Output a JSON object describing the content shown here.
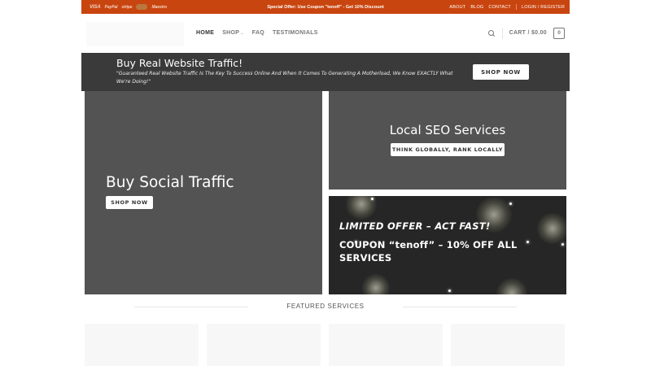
{
  "topbar": {
    "payment_icons": [
      "VISA",
      "PayPal",
      "stripe",
      "mastercard",
      "Maestro"
    ],
    "promo_text": "Special Offer: Use Coupon \"tenoff\" - Get 10% Discount",
    "links": {
      "about": "ABOUT",
      "blog": "BLOG",
      "contact": "CONTACT",
      "login": "LOGIN / REGISTER"
    },
    "background_color": "#c9450f"
  },
  "header": {
    "nav": {
      "home": "HOME",
      "shop": "SHOP",
      "faq": "FAQ",
      "testimonials": "TESTIMONIALS"
    },
    "cart_label": "CART / $0.00",
    "cart_count": "0"
  },
  "banner": {
    "title": "Buy Real Website Traffic!",
    "quote": "\"Guaranteed Real Website Traffic Is The Key To Success Online And When It Comes To Generating A Motherload, We Know EXACTLY What We're Doing!\"",
    "button": "SHOP NOW"
  },
  "tiles": {
    "social": {
      "title": "Buy Social Traffic",
      "button": "SHOP NOW"
    },
    "seo": {
      "title": "Local SEO Services",
      "button": "THINK GLOBALLY, RANK LOCALLY"
    },
    "offer": {
      "line1": "LIMITED OFFER – ACT FAST!",
      "line2": "COUPON “tenoff” – 10% OFF ALL SERVICES"
    }
  },
  "featured": {
    "title": "FEATURED SERVICES"
  }
}
